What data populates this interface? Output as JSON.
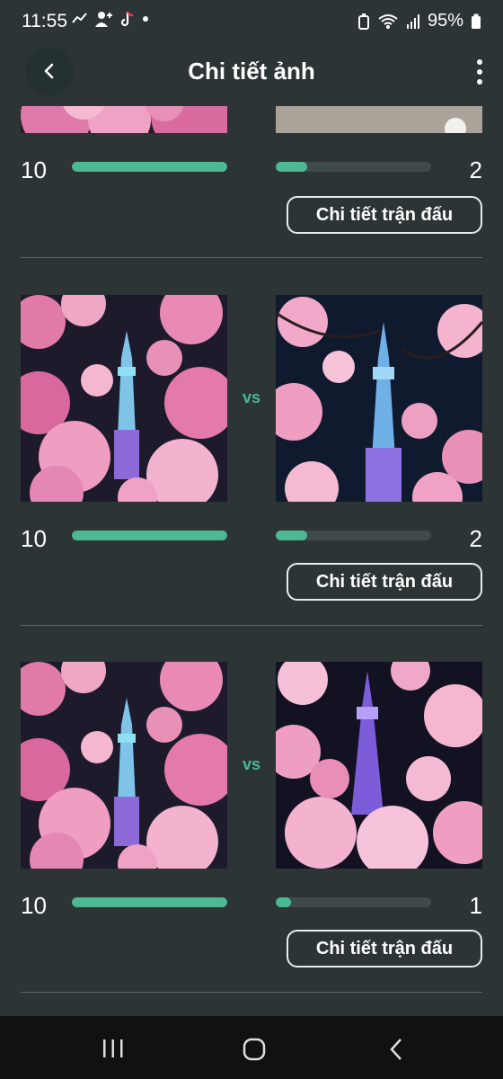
{
  "status_bar": {
    "time": "11:55",
    "battery": "95%",
    "left_icons": [
      "missed-call-icon",
      "person-add-icon",
      "tiktok-icon",
      "dot-icon"
    ],
    "right_icons": [
      "battery-saver-icon",
      "wifi-icon",
      "signal-icon",
      "battery-icon"
    ]
  },
  "app_bar": {
    "title": "Chi tiết ảnh",
    "back_icon": "chevron-left-icon",
    "menu_icon": "more-vertical-icon"
  },
  "colors": {
    "background": "#2d3435",
    "accent": "#4cb894",
    "bar_track": "#3f4a4b",
    "divider": "#56686a"
  },
  "matches": [
    {
      "left_score": "10",
      "right_score": "2",
      "left_progress": 1.0,
      "right_progress": 0.2,
      "detail_label": "Chi tiết trận đấu",
      "vs_label": ""
    },
    {
      "left_score": "10",
      "right_score": "2",
      "left_progress": 1.0,
      "right_progress": 0.2,
      "detail_label": "Chi tiết trận đấu",
      "vs_label": "vs"
    },
    {
      "left_score": "10",
      "right_score": "1",
      "left_progress": 1.0,
      "right_progress": 0.1,
      "detail_label": "Chi tiết trận đấu",
      "vs_label": "vs"
    }
  ],
  "nav_bar": {
    "icons": [
      "recent-apps-icon",
      "home-icon",
      "back-icon"
    ]
  }
}
